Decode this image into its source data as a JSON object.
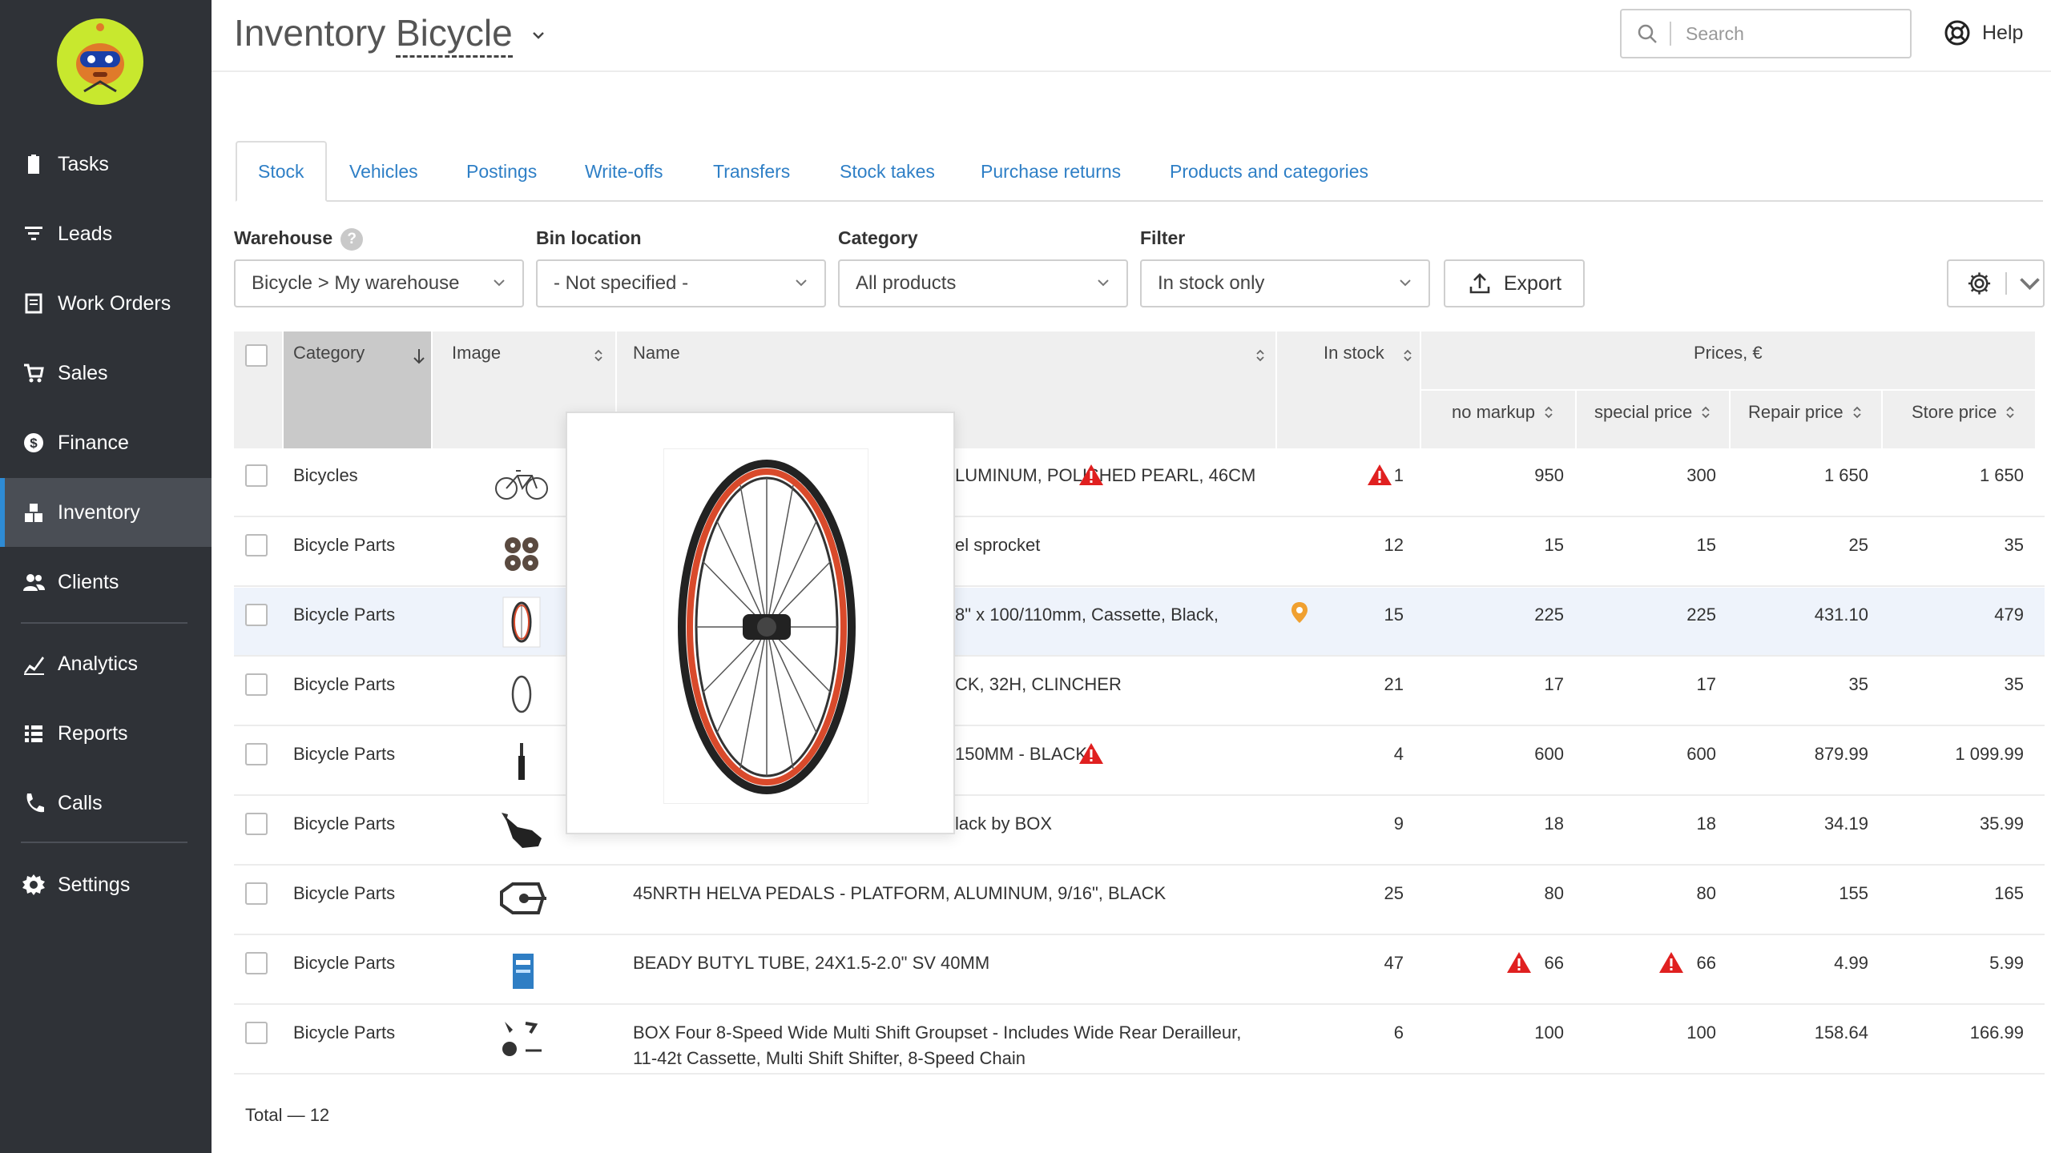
{
  "app": {
    "title": "Inventory",
    "subtitle": "Bicycle"
  },
  "search": {
    "placeholder": "Search"
  },
  "help": {
    "label": "Help"
  },
  "sidebar": {
    "items": [
      {
        "label": "Tasks",
        "icon": "clipboard-icon"
      },
      {
        "label": "Leads",
        "icon": "funnel-icon"
      },
      {
        "label": "Work Orders",
        "icon": "document-icon"
      },
      {
        "label": "Sales",
        "icon": "cart-icon"
      },
      {
        "label": "Finance",
        "icon": "dollar-icon"
      },
      {
        "label": "Inventory",
        "icon": "inventory-icon"
      },
      {
        "label": "Clients",
        "icon": "users-icon"
      },
      {
        "label": "Analytics",
        "icon": "chart-icon"
      },
      {
        "label": "Reports",
        "icon": "list-icon"
      },
      {
        "label": "Calls",
        "icon": "phone-icon"
      },
      {
        "label": "Settings",
        "icon": "gear-icon"
      }
    ],
    "active": "Inventory"
  },
  "tabs": [
    "Stock",
    "Vehicles",
    "Postings",
    "Write-offs",
    "Transfers",
    "Stock takes",
    "Purchase returns",
    "Products and categories"
  ],
  "filters": {
    "warehouse": {
      "label": "Warehouse",
      "value": "Bicycle > My warehouse"
    },
    "bin": {
      "label": "Bin location",
      "value": "- Not specified -"
    },
    "category": {
      "label": "Category",
      "value": "All products"
    },
    "filter": {
      "label": "Filter",
      "value": "In stock only"
    }
  },
  "export_label": "Export",
  "columns": {
    "category": "Category",
    "image": "Image",
    "name": "Name",
    "in_stock": "In stock",
    "prices": "Prices, €",
    "no_markup": "no markup",
    "special": "special price",
    "repair": "Repair price",
    "store": "Store price"
  },
  "rows": [
    {
      "category": "Bicycles",
      "name": "LUMINUM, POLISHED PEARL, 46CM",
      "in_stock": "1",
      "no_markup": "950",
      "special": "300",
      "repair": "1 650",
      "store": "1 650"
    },
    {
      "category": "Bicycle Parts",
      "name": "el sprocket",
      "in_stock": "12",
      "no_markup": "15",
      "special": "15",
      "repair": "25",
      "store": "35"
    },
    {
      "category": "Bicycle Parts",
      "name": "8\" x 100/110mm, Cassette, Black,",
      "in_stock": "15",
      "no_markup": "225",
      "special": "225",
      "repair": "431.10",
      "store": "479"
    },
    {
      "category": "Bicycle Parts",
      "name": "CK, 32H, CLINCHER",
      "in_stock": "21",
      "no_markup": "17",
      "special": "17",
      "repair": "35",
      "store": "35"
    },
    {
      "category": "Bicycle Parts",
      "name": "150MM - BLACK",
      "in_stock": "4",
      "no_markup": "600",
      "special": "600",
      "repair": "879.99",
      "store": "1 099.99"
    },
    {
      "category": "Bicycle Parts",
      "name": "lack by BOX",
      "in_stock": "9",
      "no_markup": "18",
      "special": "18",
      "repair": "34.19",
      "store": "35.99"
    },
    {
      "category": "Bicycle Parts",
      "name": "45NRTH HELVA PEDALS - PLATFORM, ALUMINUM, 9/16\", BLACK",
      "in_stock": "25",
      "no_markup": "80",
      "special": "80",
      "repair": "155",
      "store": "165"
    },
    {
      "category": "Bicycle Parts",
      "name": "BEADY BUTYL TUBE, 24X1.5-2.0\" SV 40MM",
      "in_stock": "47",
      "no_markup": "66",
      "special": "66",
      "repair": "4.99",
      "store": "5.99"
    },
    {
      "category": "Bicycle Parts",
      "name": "BOX Four 8-Speed Wide Multi Shift Groupset - Includes Wide Rear Derailleur,",
      "name2": "11-42t Cassette, Multi Shift Shifter, 8-Speed Chain",
      "in_stock": "6",
      "no_markup": "100",
      "special": "100",
      "repair": "158.64",
      "store": "166.99"
    }
  ],
  "total": "Total — 12"
}
